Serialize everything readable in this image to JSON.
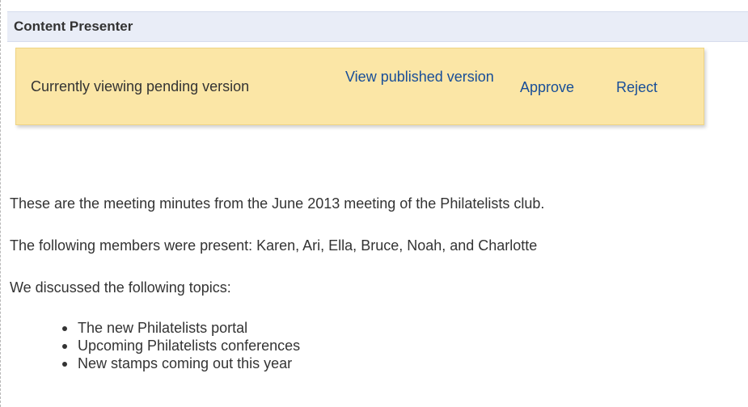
{
  "header": {
    "title": "Content Presenter"
  },
  "banner": {
    "status_text": "Currently viewing pending version",
    "view_published_label": "View published version",
    "approve_label": "Approve",
    "reject_label": "Reject"
  },
  "content": {
    "paragraph_1": "These are the meeting minutes from the June 2013 meeting of the Philatelists club.",
    "paragraph_2": "The following members were present: Karen, Ari, Ella, Bruce, Noah, and Charlotte",
    "paragraph_3": "We discussed the following topics:",
    "topics": [
      "The new Philatelists portal",
      "Upcoming Philatelists conferences",
      "New stamps coming out this year"
    ]
  },
  "colors": {
    "header_bg": "#e9edf7",
    "banner_bg": "#fbe6a6",
    "link": "#184e98",
    "text": "#333333"
  }
}
